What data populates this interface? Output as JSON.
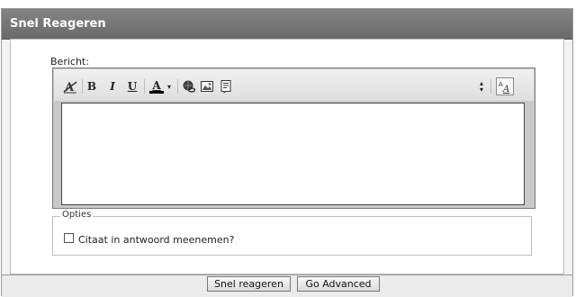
{
  "header": {
    "title": "Snel Reageren"
  },
  "editor": {
    "label": "Bericht:",
    "toolbar": {
      "bold": "B",
      "italic": "I",
      "underline": "U",
      "font_color_letter": "A",
      "dropdown_arrow": "▾",
      "switch_mode": "A",
      "resize_up": "▴",
      "resize_down": "▾"
    },
    "message_value": ""
  },
  "options": {
    "legend": "Opties",
    "quote_label": "Citaat in antwoord meenemen?"
  },
  "buttons": {
    "snel_reageren": "Snel reageren",
    "go_advanced": "Go Advanced"
  },
  "colors": {
    "header_bg": "#777777",
    "font_color_bar": "#000000"
  }
}
